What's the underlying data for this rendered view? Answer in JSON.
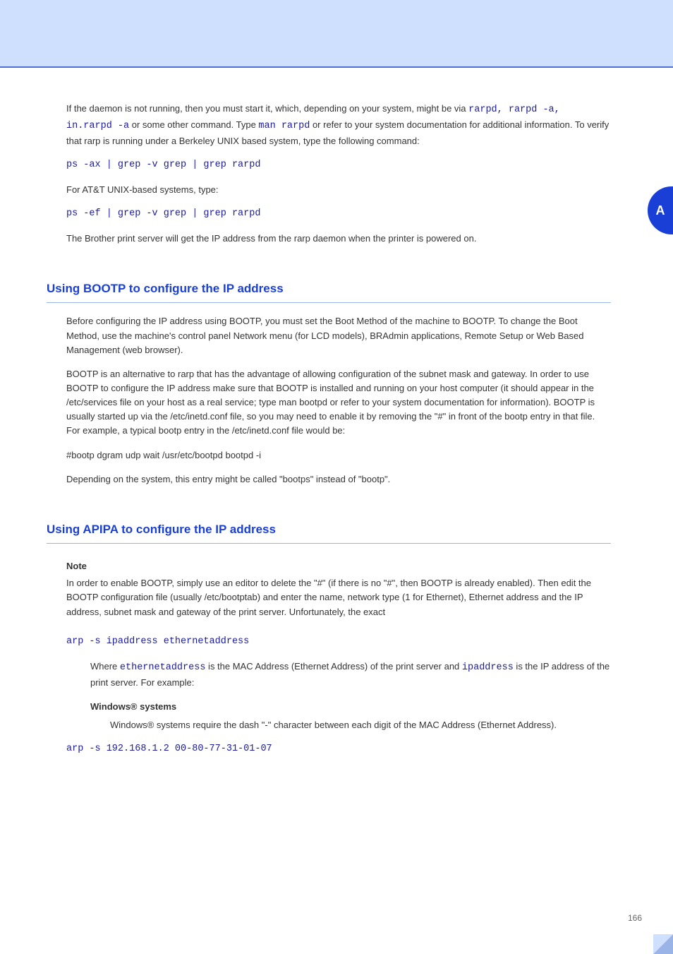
{
  "tab_number": "A",
  "prelude": {
    "p1a": "If the daemon is not running, then you must start it, which, depending on your system, might be via ",
    "cmd1": "rarpd, rarpd -a, in.rarpd -a",
    "p1b": " or some other command. Type ",
    "cmd2": "man rarpd",
    "p1c": " or refer to your system documentation for additional information. To verify that rarp is running under a Berkeley UNIX based system, type the following command:",
    "code1": "ps -ax | grep -v grep | grep rarpd",
    "p2": "For AT&T UNIX-based systems, type:",
    "code2": "ps -ef | grep -v grep | grep rarpd",
    "p3": "The Brother print server will get the IP address from the rarp daemon when the printer is powered on."
  },
  "bootp_section": {
    "heading": "Using BOOTP to configure the IP address",
    "p1": "Before configuring the IP address using BOOTP, you must set the Boot Method of the machine to BOOTP. To change the Boot Method, use the machine's control panel Network menu (for LCD models), BRAdmin applications, Remote Setup or Web Based Management (web browser).",
    "p2": "BOOTP is an alternative to rarp that has the advantage of allowing configuration of the subnet mask and gateway. In order to use BOOTP to configure the IP address make sure that BOOTP is installed and running on your host computer (it should appear in the /etc/services file on your host as a real service; type man bootpd or refer to your system documentation for information). BOOTP is usually started up via the /etc/inetd.conf file, so you may need to enable it by removing the \"#\" in front of the bootp entry in that file. For example, a typical bootp entry in the /etc/inetd.conf file would be:",
    "code1": "#bootp dgram udp wait /usr/etc/bootpd bootpd -i",
    "p3": "Depending on the system, this entry might be called \"bootps\" instead of \"bootp\"."
  },
  "arp_section": {
    "heading": "Using APIPA to configure the IP address",
    "note": {
      "title": "Note",
      "body1": "In order to enable BOOTP, simply use an editor to delete the \"#\" (if there is no \"#\", then BOOTP is already enabled). Then edit the BOOTP configuration file (usually /etc/bootptab) and enter the name, network type (1 for Ethernet), Ethernet address and the IP address, subnet mask and gateway of the print server. Unfortunately, the exact",
      "body2": ""
    },
    "p1_pre": "",
    "code1": "arp -s ipaddress ethernetaddress",
    "p2a": "Where ",
    "p2_cmd1": "ethernetaddress",
    "p2b": " is the MAC Address (Ethernet Address) of the print server and ",
    "p2_cmd2": "ipaddress",
    "p2c": " is the IP address of the print server. For example:",
    "win_heading": "Windows® systems",
    "win_p1": "Windows® systems require the dash \"-\" character between each digit of the MAC Address (Ethernet Address).",
    "code_win": "arp -s 192.168.1.2 00-80-77-31-01-07"
  },
  "page_number": "166"
}
